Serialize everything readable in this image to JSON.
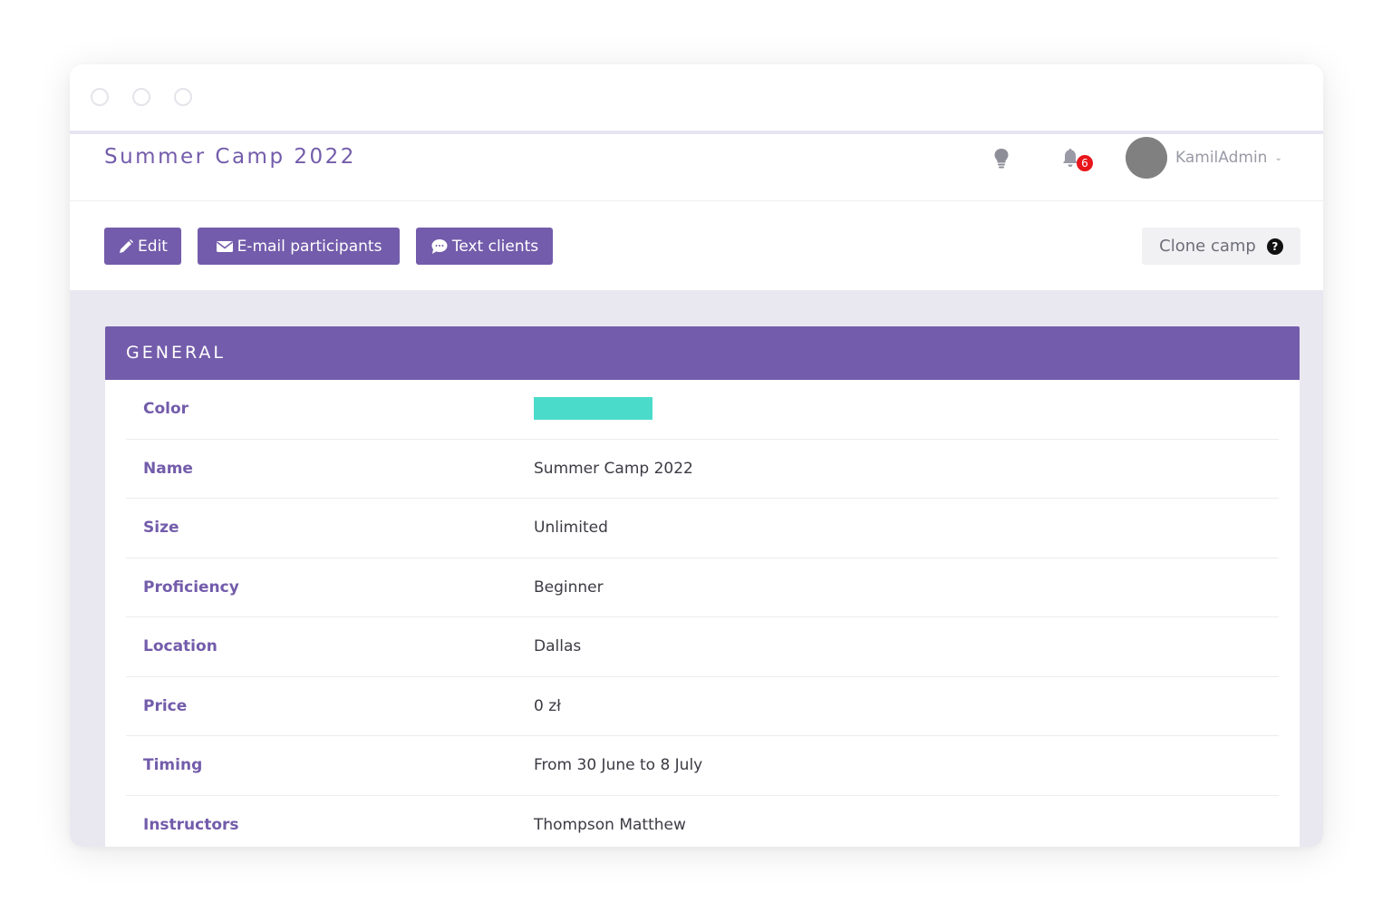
{
  "header": {
    "title": "Summer Camp 2022",
    "notification_count": "6",
    "user_name": "KamilAdmin",
    "user_chevron": "⌄"
  },
  "toolbar": {
    "edit_label": "Edit",
    "email_label": "E-mail participants",
    "text_label": "Text clients",
    "clone_label": "Clone camp",
    "clone_help": "?"
  },
  "colors": {
    "brand": "#735cab",
    "camp_color": "#4bdbcb",
    "badge": "#e8151b"
  },
  "icons": {
    "tips": "lightbulb-icon",
    "notifications": "bell-icon",
    "edit": "pencil-icon",
    "email": "envelope-icon",
    "text": "chat-bubble-icon",
    "help": "question-icon"
  },
  "general": {
    "heading": "GENERAL",
    "rows": [
      {
        "label": "Color",
        "value": ""
      },
      {
        "label": "Name",
        "value": "Summer Camp 2022"
      },
      {
        "label": "Size",
        "value": "Unlimited"
      },
      {
        "label": "Proficiency",
        "value": "Beginner"
      },
      {
        "label": "Location",
        "value": "Dallas"
      },
      {
        "label": "Price",
        "value": "0 zł"
      },
      {
        "label": "Timing",
        "value": "From 30 June to 8 July"
      },
      {
        "label": "Instructors",
        "value": "Thompson Matthew"
      }
    ]
  }
}
